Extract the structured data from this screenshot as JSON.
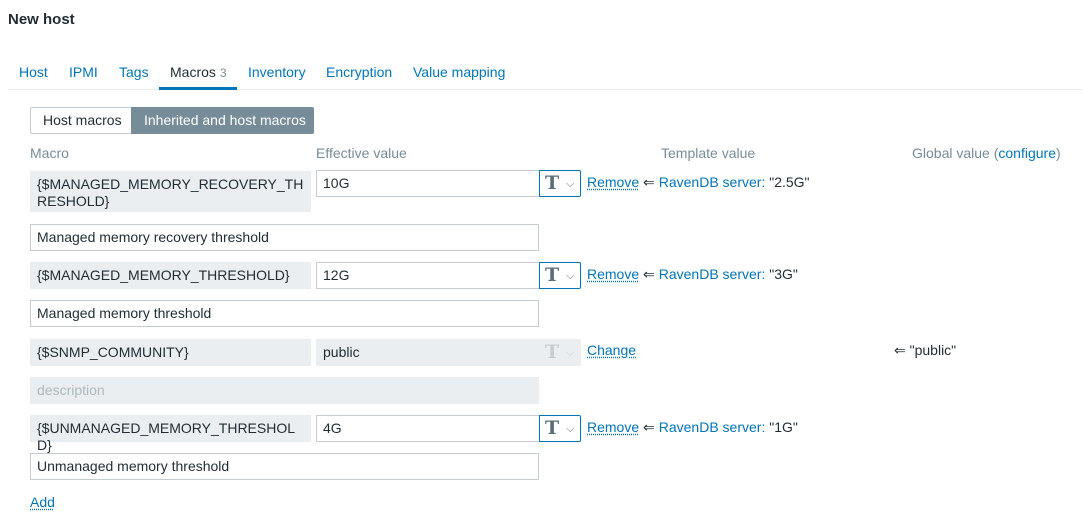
{
  "page": {
    "title": "New host"
  },
  "tabs": [
    {
      "label": "Host"
    },
    {
      "label": "IPMI"
    },
    {
      "label": "Tags"
    },
    {
      "label": "Macros",
      "count": "3"
    },
    {
      "label": "Inventory"
    },
    {
      "label": "Encryption"
    },
    {
      "label": "Value mapping"
    }
  ],
  "macro_mode": {
    "host_macros": "Host macros",
    "inherited": "Inherited and host macros"
  },
  "columns": {
    "macro": "Macro",
    "effective_value": "Effective value",
    "template_value": "Template value",
    "global_value": "Global value (",
    "configure": "configure",
    "global_close": ")"
  },
  "icons": {
    "type_icon": "T",
    "chevron": "⌵",
    "inherit_arrow": "⇐"
  },
  "macros": [
    {
      "name": "{$MANAGED_MEMORY_RECOVERY_THRESHOLD}",
      "value": "10G",
      "action": "Remove",
      "template_name": "RavenDB server:",
      "template_value": "\"2.5G\"",
      "description": "Managed memory recovery threshold"
    },
    {
      "name": "{$MANAGED_MEMORY_THRESHOLD}",
      "value": "12G",
      "action": "Remove",
      "template_name": "RavenDB server:",
      "template_value": "\"3G\"",
      "description": "Managed memory threshold"
    },
    {
      "name": "{$SNMP_COMMUNITY}",
      "value": "public",
      "action": "Change",
      "global_value": "\"public\"",
      "description_placeholder": "description"
    },
    {
      "name": "{$UNMANAGED_MEMORY_THRESHOLD}",
      "value": "4G",
      "action": "Remove",
      "template_name": "RavenDB server:",
      "template_value": "\"1G\"",
      "description": "Unmanaged memory threshold"
    }
  ],
  "add_label": "Add"
}
